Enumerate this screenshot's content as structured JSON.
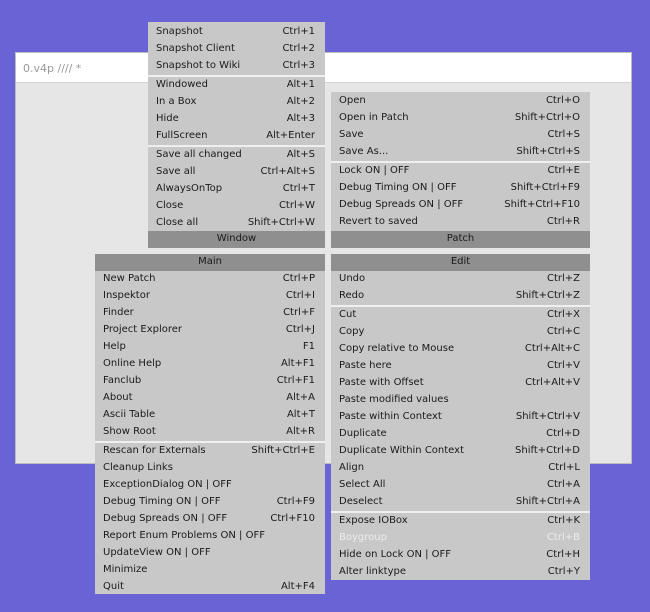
{
  "window": {
    "title": "0.v4p //// *"
  },
  "menus": {
    "window": {
      "header": "Window",
      "items": [
        {
          "label": "Snapshot",
          "shortcut": "Ctrl+1"
        },
        {
          "label": "Snapshot Client",
          "shortcut": "Ctrl+2"
        },
        {
          "label": "Snapshot to Wiki",
          "shortcut": "Ctrl+3"
        },
        {
          "label": "Windowed",
          "shortcut": "Alt+1"
        },
        {
          "label": "In a Box",
          "shortcut": "Alt+2"
        },
        {
          "label": "Hide",
          "shortcut": "Alt+3"
        },
        {
          "label": "FullScreen",
          "shortcut": "Alt+Enter"
        },
        {
          "label": "Save all changed",
          "shortcut": "Alt+S"
        },
        {
          "label": "Save all",
          "shortcut": "Ctrl+Alt+S"
        },
        {
          "label": "AlwaysOnTop",
          "shortcut": "Ctrl+T"
        },
        {
          "label": "Close",
          "shortcut": "Ctrl+W"
        },
        {
          "label": "Close all",
          "shortcut": "Shift+Ctrl+W"
        }
      ]
    },
    "patch": {
      "header": "Patch",
      "items": [
        {
          "label": "Open",
          "shortcut": "Ctrl+O"
        },
        {
          "label": "Open in Patch",
          "shortcut": "Shift+Ctrl+O"
        },
        {
          "label": "Save",
          "shortcut": "Ctrl+S"
        },
        {
          "label": "Save As...",
          "shortcut": "Shift+Ctrl+S"
        },
        {
          "label": "Lock ON | OFF",
          "shortcut": "Ctrl+E"
        },
        {
          "label": "Debug Timing ON | OFF",
          "shortcut": "Shift+Ctrl+F9"
        },
        {
          "label": "Debug Spreads ON | OFF",
          "shortcut": "Shift+Ctrl+F10"
        },
        {
          "label": "Revert to saved",
          "shortcut": "Ctrl+R"
        }
      ]
    },
    "main": {
      "header": "Main",
      "items": [
        {
          "label": "New Patch",
          "shortcut": "Ctrl+P"
        },
        {
          "label": "Inspektor",
          "shortcut": "Ctrl+I"
        },
        {
          "label": "Finder",
          "shortcut": "Ctrl+F"
        },
        {
          "label": "Project Explorer",
          "shortcut": "Ctrl+J"
        },
        {
          "label": "Help",
          "shortcut": "F1"
        },
        {
          "label": "Online Help",
          "shortcut": "Alt+F1"
        },
        {
          "label": "Fanclub",
          "shortcut": "Ctrl+F1"
        },
        {
          "label": "About",
          "shortcut": "Alt+A"
        },
        {
          "label": "Ascii Table",
          "shortcut": "Alt+T"
        },
        {
          "label": "Show Root",
          "shortcut": "Alt+R"
        },
        {
          "label": "Rescan for Externals",
          "shortcut": "Shift+Ctrl+E"
        },
        {
          "label": "Cleanup Links",
          "shortcut": ""
        },
        {
          "label": "ExceptionDialog ON | OFF",
          "shortcut": ""
        },
        {
          "label": "Debug Timing ON | OFF",
          "shortcut": "Ctrl+F9"
        },
        {
          "label": "Debug Spreads ON | OFF",
          "shortcut": "Ctrl+F10"
        },
        {
          "label": "Report Enum Problems ON | OFF",
          "shortcut": ""
        },
        {
          "label": "UpdateView ON | OFF",
          "shortcut": ""
        },
        {
          "label": "Minimize",
          "shortcut": ""
        },
        {
          "label": "Quit",
          "shortcut": "Alt+F4"
        }
      ]
    },
    "edit": {
      "header": "Edit",
      "items": [
        {
          "label": "Undo",
          "shortcut": "Ctrl+Z"
        },
        {
          "label": "Redo",
          "shortcut": "Shift+Ctrl+Z"
        },
        {
          "label": "Cut",
          "shortcut": "Ctrl+X"
        },
        {
          "label": "Copy",
          "shortcut": "Ctrl+C"
        },
        {
          "label": "Copy relative to Mouse",
          "shortcut": "Ctrl+Alt+C"
        },
        {
          "label": "Paste here",
          "shortcut": "Ctrl+V"
        },
        {
          "label": "Paste with Offset",
          "shortcut": "Ctrl+Alt+V"
        },
        {
          "label": "Paste modified values",
          "shortcut": ""
        },
        {
          "label": "Paste within Context",
          "shortcut": "Shift+Ctrl+V"
        },
        {
          "label": "Duplicate",
          "shortcut": "Ctrl+D"
        },
        {
          "label": "Duplicate Within Context",
          "shortcut": "Shift+Ctrl+D"
        },
        {
          "label": "Align",
          "shortcut": "Ctrl+L"
        },
        {
          "label": "Select All",
          "shortcut": "Ctrl+A"
        },
        {
          "label": "Deselect",
          "shortcut": "Shift+Ctrl+A"
        },
        {
          "label": "Expose IOBox",
          "shortcut": "Ctrl+K"
        },
        {
          "label": "Boygroup",
          "shortcut": "Ctrl+B"
        },
        {
          "label": "Hide on Lock ON | OFF",
          "shortcut": "Ctrl+H"
        },
        {
          "label": "Alter linktype",
          "shortcut": "Ctrl+Y"
        }
      ]
    }
  }
}
